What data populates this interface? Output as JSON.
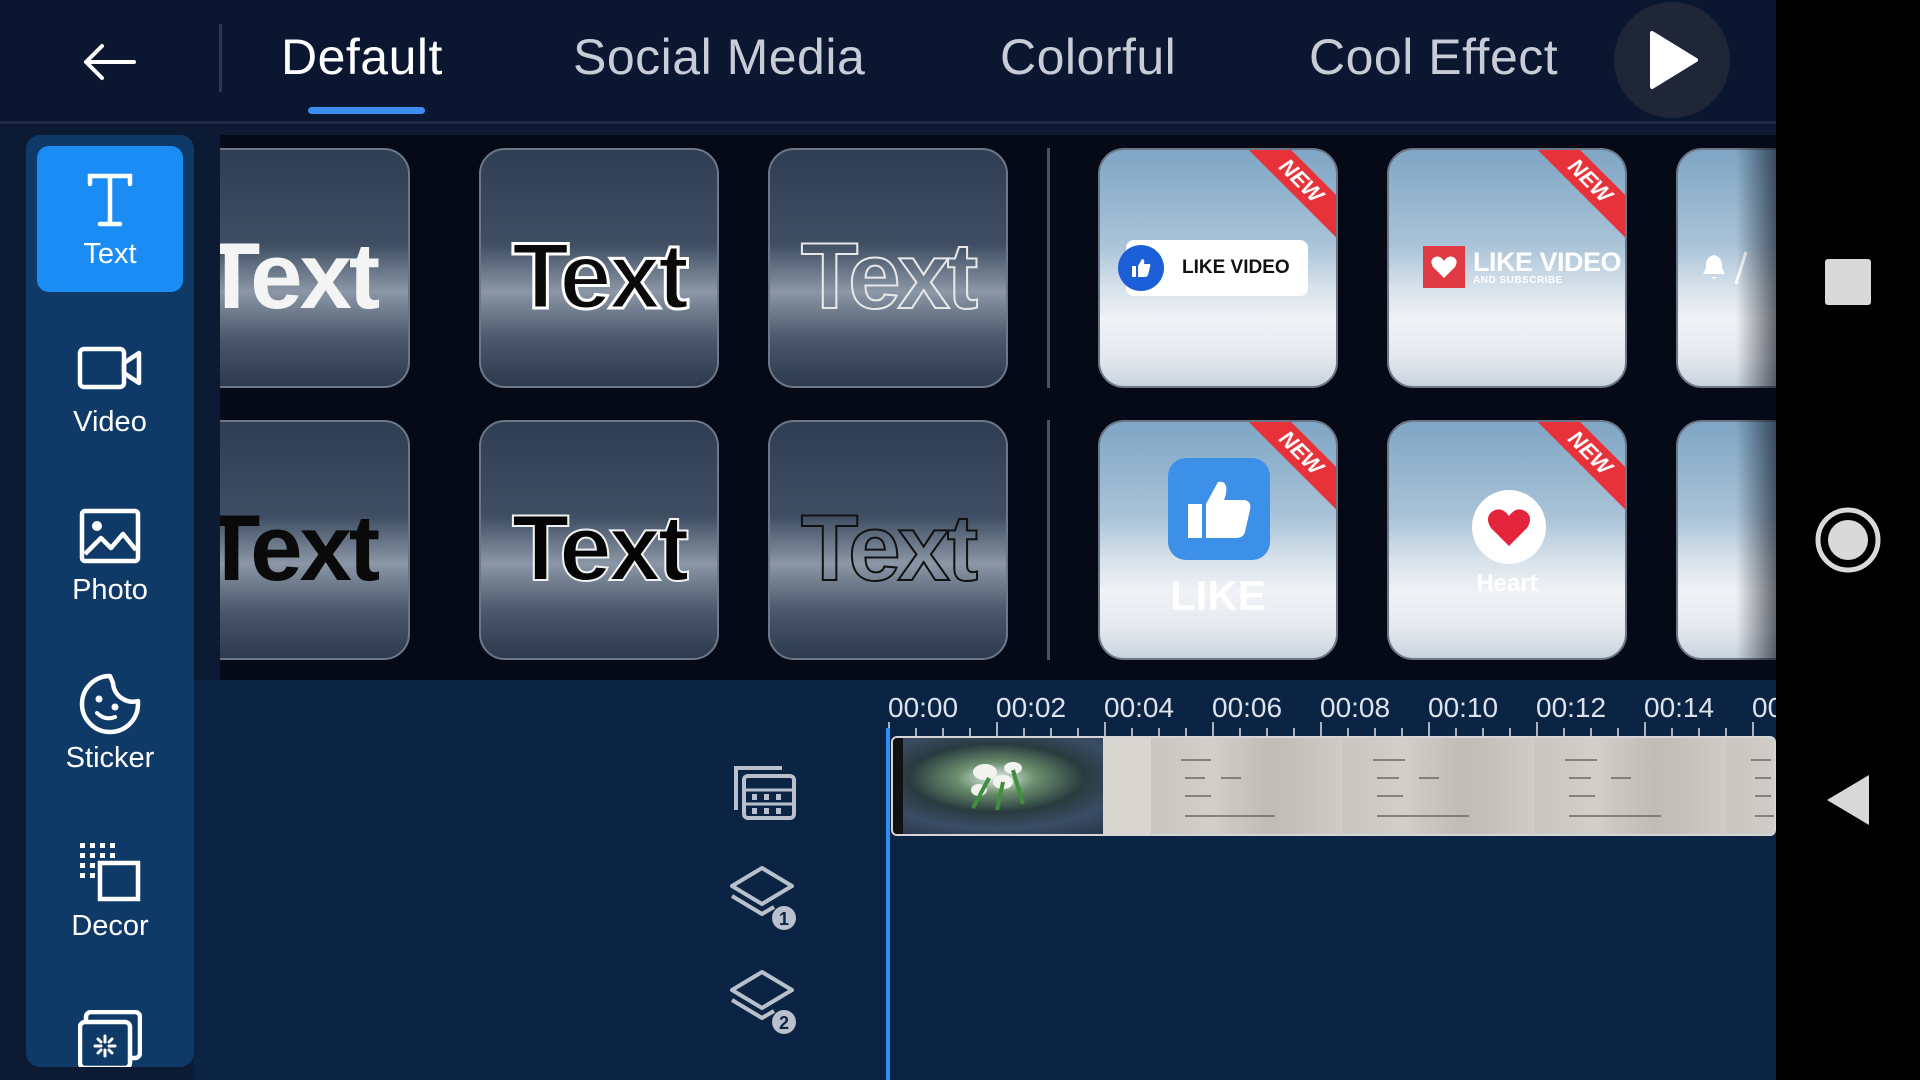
{
  "header": {
    "tabs": [
      {
        "label": "Default",
        "active": true
      },
      {
        "label": "Social Media",
        "active": false
      },
      {
        "label": "Colorful",
        "active": false
      },
      {
        "label": "Cool Effect",
        "active": false
      }
    ],
    "accent_color": "#3b8ef0"
  },
  "sidebar": {
    "items": [
      {
        "label": "Text",
        "icon": "text-icon",
        "active": true
      },
      {
        "label": "Video",
        "icon": "video-camera-icon",
        "active": false
      },
      {
        "label": "Photo",
        "icon": "photo-icon",
        "active": false
      },
      {
        "label": "Sticker",
        "icon": "sticker-icon",
        "active": false
      },
      {
        "label": "Decor",
        "icon": "decor-icon",
        "active": false
      },
      {
        "label": "",
        "icon": "effect-icon",
        "active": false
      }
    ],
    "active_color": "#1b8cf3"
  },
  "templates": {
    "sample_text": "Text",
    "badge_new": "NEW",
    "like_video_label": "LIKE VIDEO",
    "like_video_sub": "AND SUBSCRIBE",
    "like_label": "LIKE",
    "heart_label": "Heart"
  },
  "timeline": {
    "ruler": [
      "00:00",
      "00:02",
      "00:04",
      "00:06",
      "00:08",
      "00:10",
      "00:12",
      "00:14",
      "00"
    ],
    "tracks": [
      {
        "icon": "video-track-icon"
      },
      {
        "icon": "layer-1-icon",
        "number": "1"
      },
      {
        "icon": "layer-2-icon",
        "number": "2"
      }
    ]
  },
  "navbar": {
    "buttons": [
      {
        "icon": "recents-square-icon"
      },
      {
        "icon": "home-circle-icon"
      },
      {
        "icon": "back-triangle-icon"
      }
    ]
  }
}
